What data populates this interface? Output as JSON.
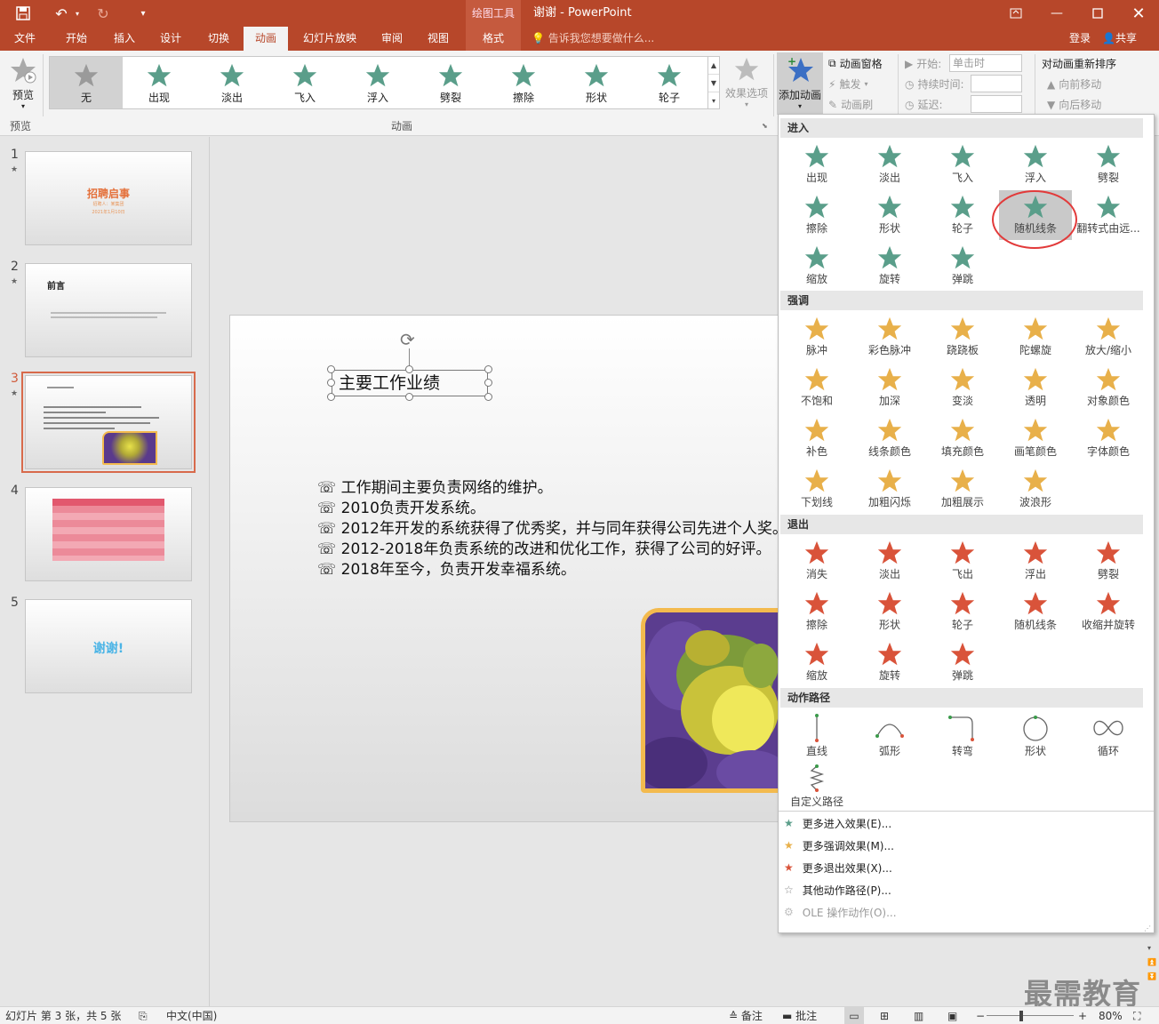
{
  "titlebar": {
    "context_label": "绘图工具",
    "doc_title": "谢谢 - PowerPoint"
  },
  "tabs": [
    "文件",
    "开始",
    "插入",
    "设计",
    "切换",
    "动画",
    "幻灯片放映",
    "审阅",
    "视图",
    "格式"
  ],
  "tell_me": "告诉我您想要做什么...",
  "login": "登录",
  "share": "共享",
  "ribbon": {
    "preview_label": "预览",
    "preview_group": "预览",
    "animation_group": "动画",
    "gallery": [
      "无",
      "出现",
      "淡出",
      "飞入",
      "浮入",
      "劈裂",
      "擦除",
      "形状",
      "轮子"
    ],
    "effect_options": "效果选项",
    "add_animation": "添加动画",
    "animation_pane": "动画窗格",
    "trigger": "触发",
    "animation_painter": "动画刷",
    "start_label": "开始:",
    "start_value": "单击时",
    "duration_label": "持续时间:",
    "delay_label": "延迟:",
    "reorder_title": "对动画重新排序",
    "move_earlier": "向前移动",
    "move_later": "向后移动"
  },
  "slides": {
    "s1_title": "招聘启事",
    "s1_sub1": "招聘人：某集团",
    "s1_sub2": "2021年1月10日",
    "s2_title": "前言",
    "s5_text": "谢谢!"
  },
  "slide": {
    "title": "主要工作业绩",
    "bullets": [
      "工作期间主要负责网络的维护。",
      "2010负责开发系统。",
      "2012年开发的系统获得了优秀奖，并与同年获得公司先进个人奖。",
      "2012-2018年负责系统的改进和优化工作，获得了公司的好评。",
      "2018年至今，负责开发幸福系统。"
    ]
  },
  "dropdown": {
    "entrance_header": "进入",
    "entrance": [
      "出现",
      "淡出",
      "飞入",
      "浮入",
      "劈裂",
      "擦除",
      "形状",
      "轮子",
      "随机线条",
      "翻转式由远...",
      "缩放",
      "旋转",
      "弹跳"
    ],
    "emphasis_header": "强调",
    "emphasis": [
      "脉冲",
      "彩色脉冲",
      "跷跷板",
      "陀螺旋",
      "放大/缩小",
      "不饱和",
      "加深",
      "变淡",
      "透明",
      "对象颜色",
      "补色",
      "线条颜色",
      "填充颜色",
      "画笔颜色",
      "字体颜色",
      "下划线",
      "加粗闪烁",
      "加粗展示",
      "波浪形"
    ],
    "exit_header": "退出",
    "exit": [
      "消失",
      "淡出",
      "飞出",
      "浮出",
      "劈裂",
      "擦除",
      "形状",
      "轮子",
      "随机线条",
      "收缩并旋转",
      "缩放",
      "旋转",
      "弹跳"
    ],
    "path_header": "动作路径",
    "paths": [
      "直线",
      "弧形",
      "转弯",
      "形状",
      "循环",
      "自定义路径"
    ],
    "more": [
      "更多进入效果(E)...",
      "更多强调效果(M)...",
      "更多退出效果(X)...",
      "其他动作路径(P)...",
      "OLE 操作动作(O)..."
    ],
    "colors": {
      "entrance": "#5a9e8a",
      "emphasis": "#e8b04a",
      "exit": "#d9533a"
    }
  },
  "status": {
    "slide_info": "幻灯片 第 3 张，共 5 张",
    "language": "中文(中国)",
    "notes": "备注",
    "comments": "批注",
    "zoom": "80%"
  },
  "watermark": "最需教育"
}
